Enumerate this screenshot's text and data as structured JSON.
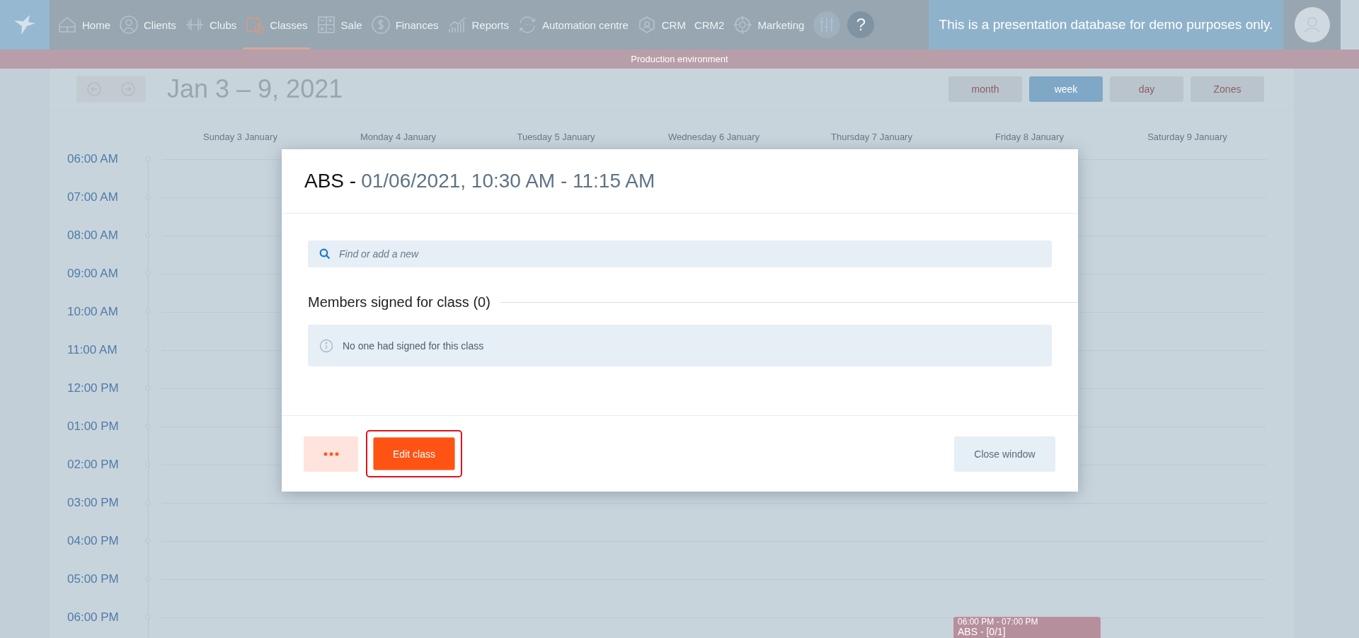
{
  "nav": {
    "items": [
      {
        "label": "Home",
        "selected": false
      },
      {
        "label": "Clients",
        "selected": false
      },
      {
        "label": "Clubs",
        "selected": false
      },
      {
        "label": "Classes",
        "selected": true
      },
      {
        "label": "Sale",
        "selected": false
      },
      {
        "label": "Finances",
        "selected": false
      },
      {
        "label": "Reports",
        "selected": false
      },
      {
        "label": "Automation centre",
        "selected": false
      },
      {
        "label": "CRM",
        "selected": false
      },
      {
        "label": "CRM2",
        "selected": false
      },
      {
        "label": "Marketing",
        "selected": false
      }
    ],
    "help": "?"
  },
  "demo_banner": "This is a presentation database for demo purposes only.",
  "environment_bar": "Production environment",
  "calendar": {
    "range": "Jan 3 – 9, 2021",
    "views": [
      {
        "label": "month",
        "selected": false
      },
      {
        "label": "week",
        "selected": true
      },
      {
        "label": "day",
        "selected": false
      },
      {
        "label": "Zones",
        "selected": false
      }
    ],
    "days": [
      {
        "label": "Sunday 3 January"
      },
      {
        "label": "Monday 4 January"
      },
      {
        "label": "Tuesday 5 January"
      },
      {
        "label": "Wednesday 6 January"
      },
      {
        "label": "Thursday 7 January"
      },
      {
        "label": "Friday 8 January",
        "events": [
          {
            "time": "06:00 PM - 07:00 PM",
            "title": "ABS - [0/1]"
          }
        ]
      },
      {
        "label": "Saturday 9 January"
      }
    ],
    "times": [
      "06:00 AM",
      "07:00 AM",
      "08:00 AM",
      "09:00 AM",
      "10:00 AM",
      "11:00 AM",
      "12:00 PM",
      "01:00 PM",
      "02:00 PM",
      "03:00 PM",
      "04:00 PM",
      "05:00 PM",
      "06:00 PM"
    ]
  },
  "dialog": {
    "class_name": "ABS -",
    "when": "01/06/2021, 10:30 AM - 11:15 AM",
    "search": {
      "placeholder": "Find or add a new"
    },
    "section_title": "Members signed for class (0)",
    "info": "No one had signed for this class",
    "edit_button": {
      "label": "Edit class",
      "highlighted": true
    },
    "close_button": "Close window"
  }
}
